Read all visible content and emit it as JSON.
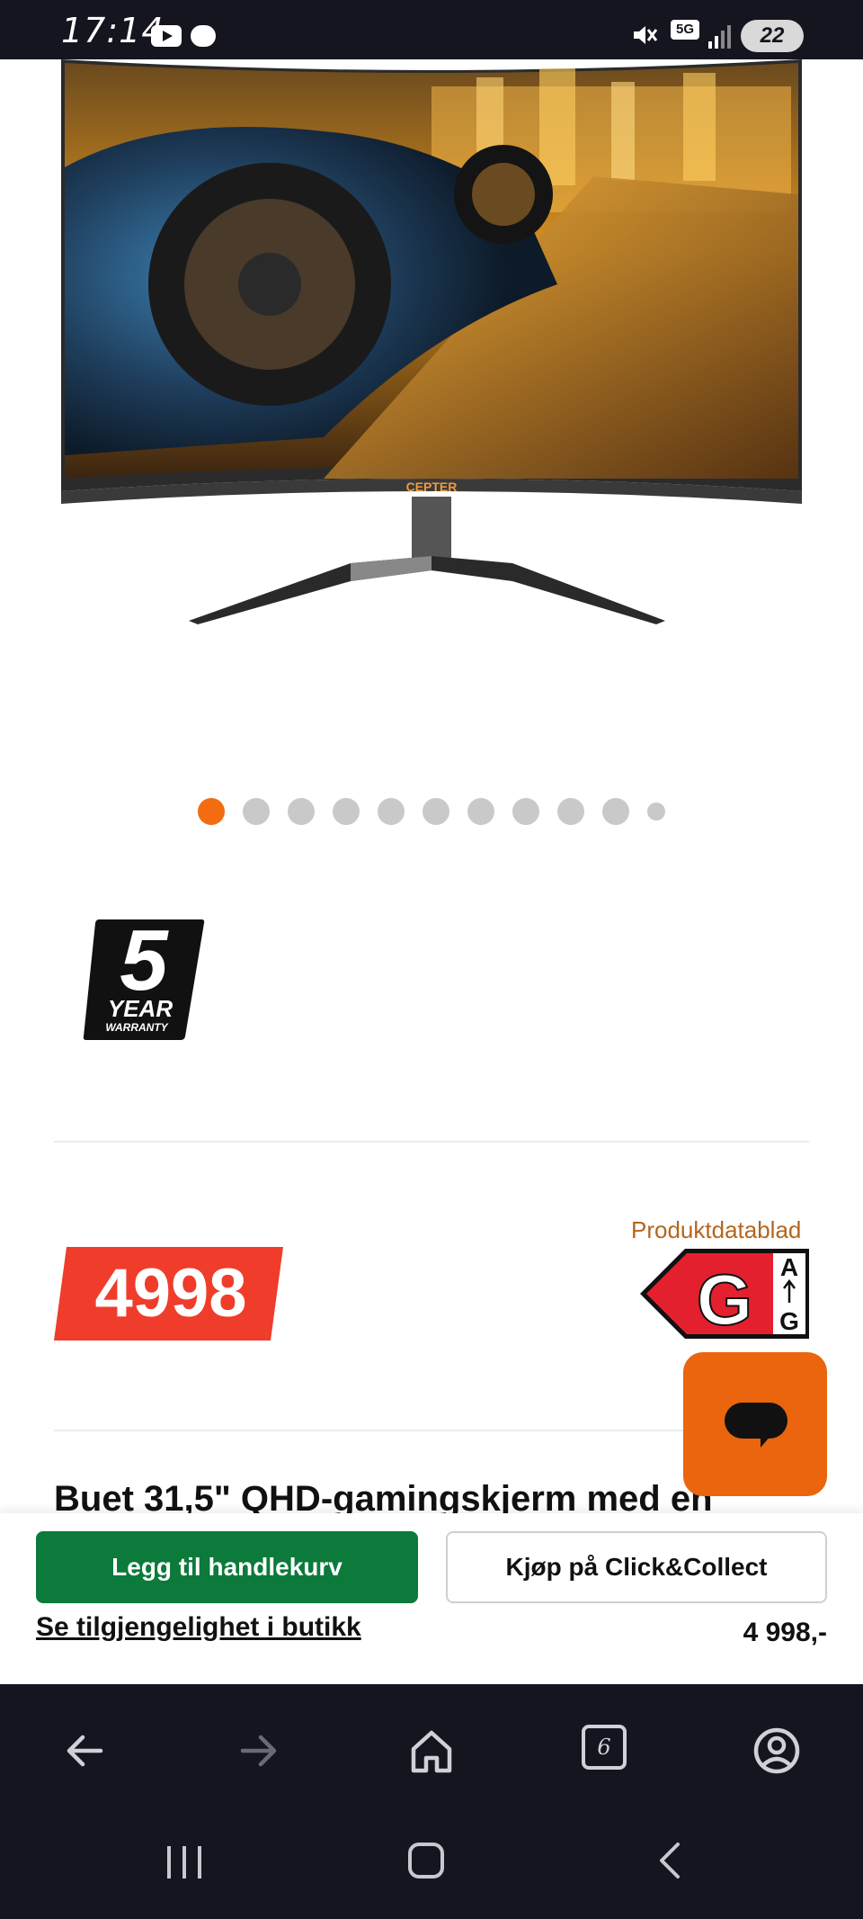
{
  "status_bar": {
    "time": "17:14",
    "network": "5G",
    "battery": "22",
    "icons": [
      "youtube-icon",
      "chat-notification-icon",
      "mute-icon",
      "signal-icon",
      "battery-icon"
    ]
  },
  "product": {
    "brand_on_image": "CEPTER",
    "carousel": {
      "total_dots": 11,
      "active_index": 0
    },
    "warranty_badge": {
      "number": "5",
      "line1": "YEAR",
      "line2": "WARRANTY"
    },
    "price_tag": "4998",
    "datasheet_link": "Produktdatablad",
    "energy_label": {
      "class": "G",
      "scale_top": "A",
      "scale_bottom": "G"
    },
    "description_title": "Buet 31,5\" QHD-gamingskjerm med en"
  },
  "buy_bar": {
    "add_to_cart": "Legg til handlekurv",
    "click_collect": "Kjøp på Click&Collect",
    "availability_link": "Se tilgjengelighet i butikk",
    "price": "4 998,-"
  },
  "browser_toolbar": {
    "tab_count": "6",
    "icons": [
      "back-arrow-icon",
      "forward-arrow-icon",
      "home-icon",
      "tabs-icon",
      "account-icon"
    ]
  },
  "system_nav": {
    "icons": [
      "recent-apps-icon",
      "home-button-icon",
      "back-icon"
    ]
  },
  "colors": {
    "accent_orange": "#f36c12",
    "price_red": "#f03c2a",
    "cart_green": "#0b7a3b",
    "chat_orange": "#ea650d",
    "bar_dark": "#14151f"
  }
}
